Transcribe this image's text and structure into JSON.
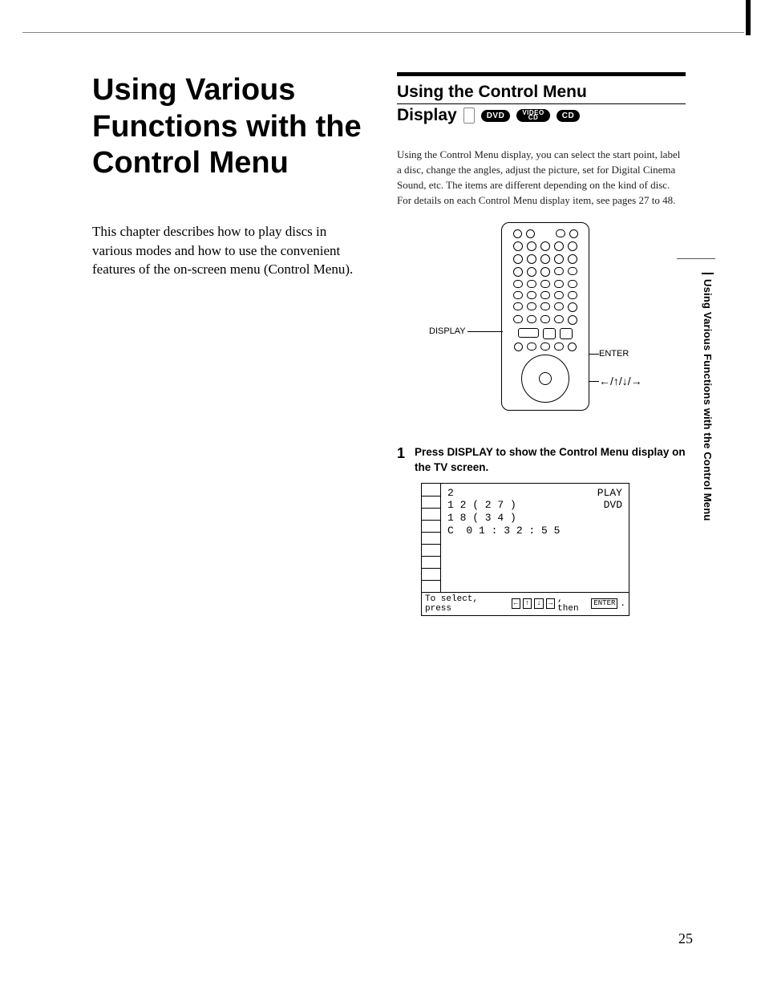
{
  "chapter": {
    "title": "Using Various Functions with the Control Menu",
    "intro": "This chapter describes how to play discs in various modes and how to use the convenient features of the on-screen menu (Control Menu)."
  },
  "section": {
    "title": "Using the Control Menu",
    "subtitle": "Display",
    "badges": {
      "dvd": "DVD",
      "videocd_top": "VIDEO",
      "videocd_bot": "CD",
      "cd": "CD"
    },
    "body": "Using the Control Menu display, you can select the start point, label a disc, change the angles, adjust the picture, set for Digital Cinema Sound, etc.\nThe items are different depending on the kind of disc. For details on each Control Menu display item, see pages 27 to 48."
  },
  "remote": {
    "label_display": "DISPLAY",
    "label_enter": "ENTER",
    "label_arrows": "←/↑/↓/→"
  },
  "step1": {
    "num": "1",
    "text": "Press DISPLAY to show the Control Menu display on the TV screen."
  },
  "tv": {
    "line1": "2",
    "line2": "1 2 ( 2 7 )",
    "line3": "1 8 ( 3 4 )",
    "line4": "C  0 1 : 3 2 : 5 5",
    "right1": "PLAY",
    "right2": "DVD",
    "footer_prefix": "To select, press",
    "footer_suffix": ", then",
    "footer_enter": "ENTER"
  },
  "side_tab": "Using Various Functions with the Control Menu",
  "page_number": "25"
}
